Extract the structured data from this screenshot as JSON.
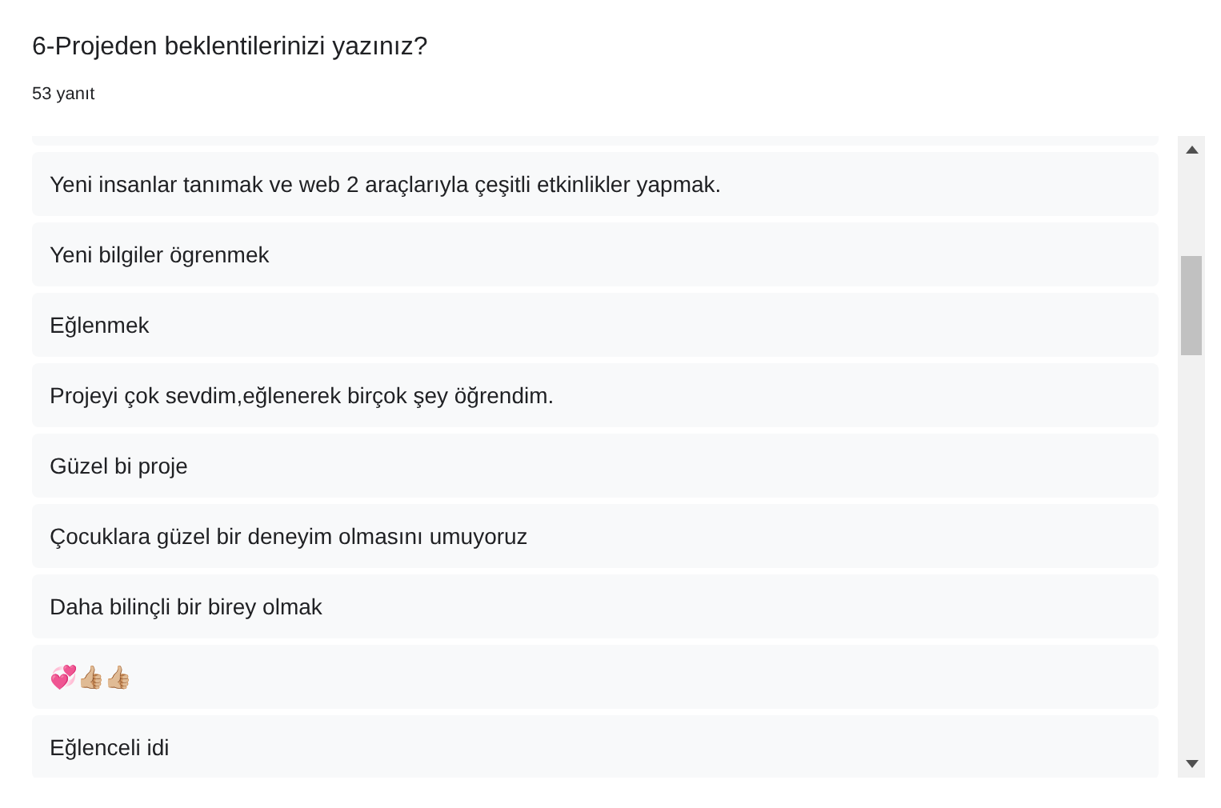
{
  "question": {
    "title": "6-Projeden beklentilerinizi yazınız?",
    "count": "53 yanıt"
  },
  "responses": [
    {
      "text": "Yeni insanlar tanımak ve web 2 araçlarıyla çeşitli etkinlikler yapmak."
    },
    {
      "text": "Yeni bilgiler ögrenmek"
    },
    {
      "text": "Eğlenmek"
    },
    {
      "text": "Projeyi çok sevdim,eğlenerek birçok şey öğrendim."
    },
    {
      "text": "Güzel bi proje"
    },
    {
      "text": "Çocuklara güzel bir deneyim olmasını umuyoruz"
    },
    {
      "text": "Daha bilinçli bir birey olmak"
    },
    {
      "text": "💞👍🏼👍🏼"
    },
    {
      "text": "Eğlenceli idi"
    }
  ]
}
